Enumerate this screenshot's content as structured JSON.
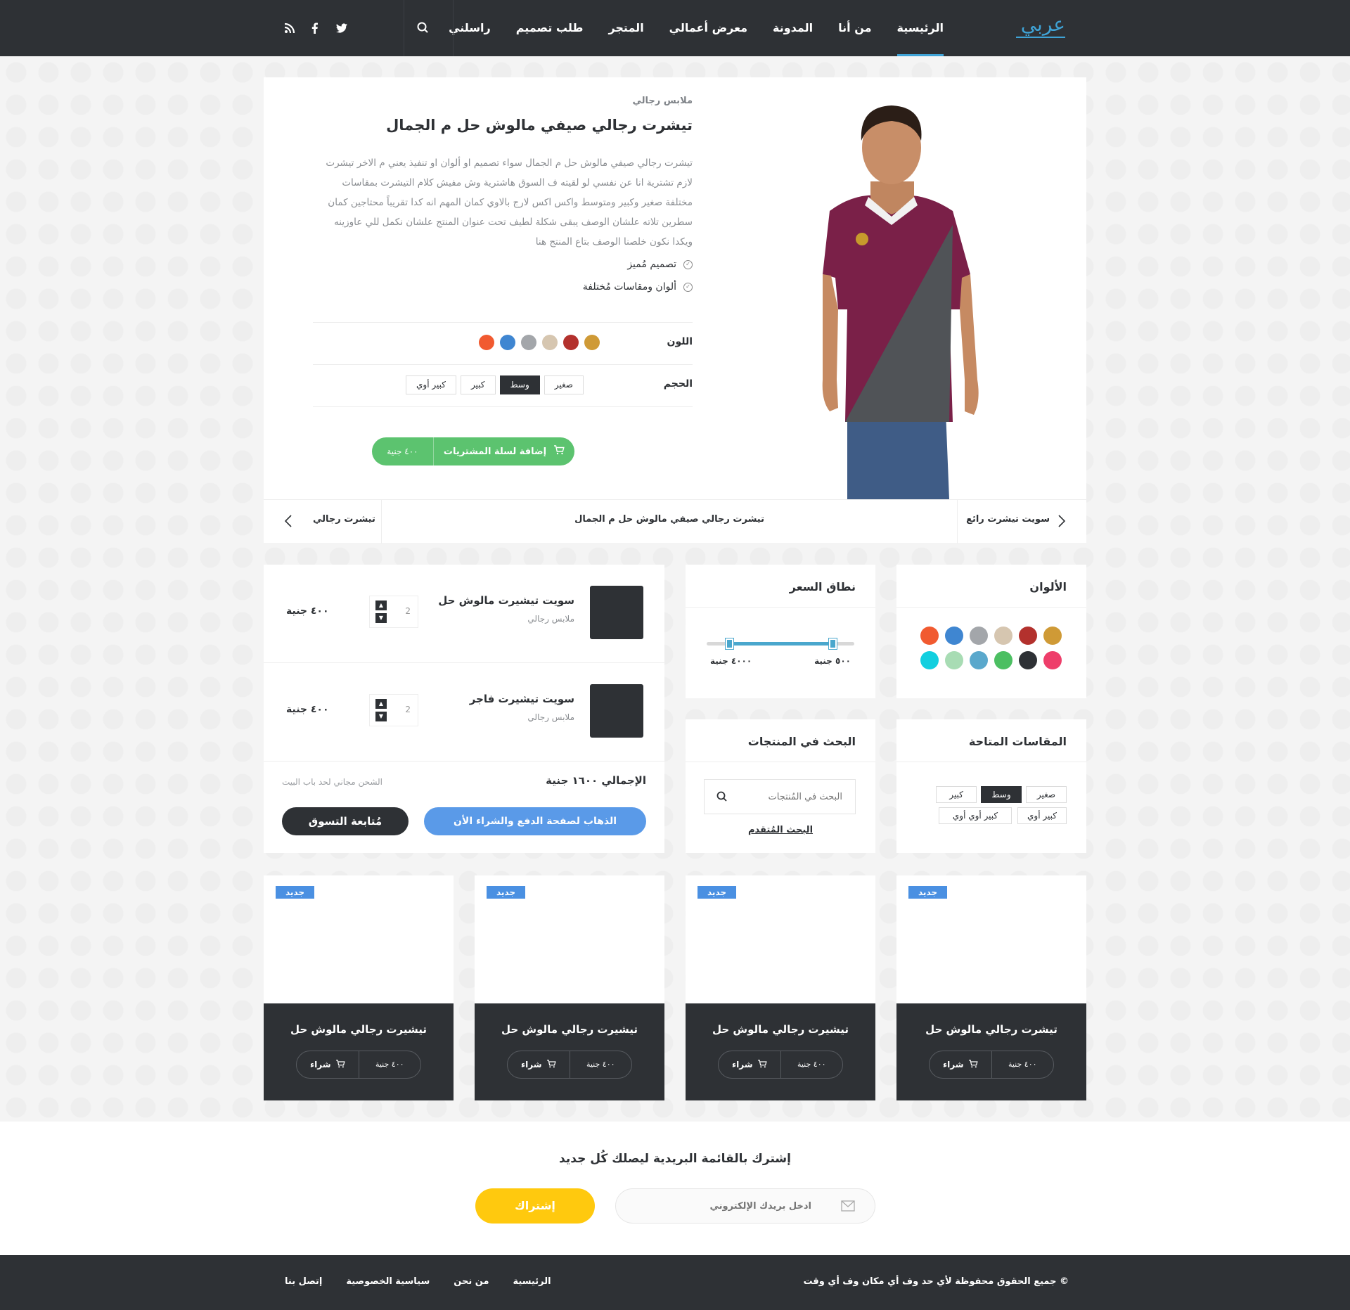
{
  "header": {
    "logo": "عربي",
    "nav": [
      "الرئيسية",
      "من أنا",
      "المدونة",
      "معرض أعمالي",
      "المتجر",
      "طلب تصميم",
      "راسلني"
    ],
    "active_index": 0
  },
  "product": {
    "category": "ملابس رجالي",
    "title": "تيشرت رجالي صيفي مالوش حل م الجمال",
    "description": "تيشرت رجالي صيفي مالوش حل م الجمال سواء تصميم او ألوان او تنفيذ يعني م الاخر تيشرت لازم تشترية انا عن نفسي لو لقيته ف السوق هاشترية وش مفيش كلام التيشرت بمقاسات مختلفة صغير وكبير ومتوسط واكس اكس لارج بالاوي كمان المهم انه كدا تقريباً محتاجين كمان سطرين تلاته علشان الوصف يبقى شكلة لطيف تحت عنوان المنتج علشان نكمل للي عاوزينه ويكدا نكون خلصنا الوصف بتاع المنتج هنا",
    "features": [
      "تصميم مُميز",
      "ألوان ومقاسات مُختلفة"
    ],
    "color_label": "اللون",
    "colors": [
      "#f15a30",
      "#3f86d1",
      "#a3a6aa",
      "#d6c6b0",
      "#b3312d",
      "#cf9a36"
    ],
    "size_label": "الحجم",
    "sizes": [
      "صغير",
      "وسط",
      "كبير",
      "كبير أوي"
    ],
    "selected_size": "وسط",
    "add_to_cart": "إضافة لسلة المشتريات",
    "price": "٤٠٠ جنية"
  },
  "pager": {
    "next": "سويت تيشرت رائع",
    "current": "تيشرت رجالي صيفي مالوش حل م الجمال",
    "prev": "تيشرت رجالي"
  },
  "widgets": {
    "colors_title": "الألوان",
    "swatches": [
      "#cf9a36",
      "#b3312d",
      "#d6c6b0",
      "#a3a6aa",
      "#3f86d1",
      "#f15a30",
      "#ee3e6a",
      "#2e3135",
      "#4cbf62",
      "#5aa8cc",
      "#a8dcb4",
      "#12cfdf"
    ],
    "price_title": "نطاق السعر",
    "price_min": "٥٠٠ جنية",
    "price_max": "٤٠٠٠ جنية",
    "price_range_low": 0.15,
    "price_range_high": 0.85,
    "sizes_title": "المقاسات المتاحة",
    "sizes": [
      "صغير",
      "وسط",
      "كبير",
      "كبير أوي",
      "كبير أوي أوي"
    ],
    "selected_size": "وسط",
    "search_title": "البحث في المنتجات",
    "search_placeholder": "البحث في المُنتجات",
    "advanced_search": "البحث المُتقدم"
  },
  "cart": {
    "items": [
      {
        "name": "سويت تيشيرت مالوش حل",
        "category": "ملابس رجالي",
        "qty": "2",
        "price": "٤٠٠ جنية"
      },
      {
        "name": "سويت تيشيرت فاجر",
        "category": "ملابس رجالي",
        "qty": "2",
        "price": "٤٠٠ جنية"
      }
    ],
    "total": "الإجمالي ١٦٠٠ جنية",
    "shipping": "الشحن مجاني لحد باب البيت",
    "pay": "الذهاب لصفحة الدفع والشراء الأن",
    "continue": "مُتابعة التسوق"
  },
  "products": [
    {
      "badge": "جديد",
      "name": "تيشيرت رجالي مالوش حل",
      "price": "٤٠٠ جنية",
      "buy": "شراء"
    },
    {
      "badge": "جديد",
      "name": "تيشيرت رجالي مالوش حل",
      "price": "٤٠٠ جنية",
      "buy": "شراء"
    },
    {
      "badge": "جديد",
      "name": "تيشيرت رجالي مالوش حل",
      "price": "٤٠٠ جنية",
      "buy": "شراء"
    },
    {
      "badge": "جديد",
      "name": "تيشرت رجالي مالوش حل",
      "price": "٤٠٠ جنية",
      "buy": "شراء"
    }
  ],
  "newsletter": {
    "title": "إشترك بالقائمة البريدية ليصلك كُل جديد",
    "placeholder": "ادخل بريدك الإلكتروني",
    "button": "إشتراك"
  },
  "footer": {
    "copyright": "© جميع الحقوق محفوظة لأي حد وف أي مكان وف أي وقت",
    "links": [
      "الرئيسية",
      "من نحن",
      "سياسية الخصوصية",
      "إتصل بنا"
    ]
  },
  "icons": {
    "search": "search-icon",
    "twitter": "twitter-icon",
    "facebook": "facebook-icon",
    "rss": "rss-icon",
    "cart": "cart-icon",
    "check": "check-circle-icon",
    "mail": "mail-icon",
    "chevron_left": "chevron-left-icon",
    "chevron_right": "chevron-right-icon"
  }
}
